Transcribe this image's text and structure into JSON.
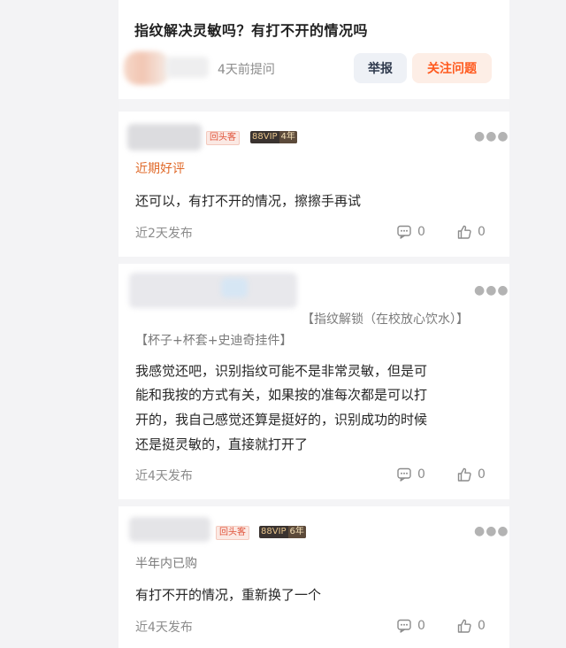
{
  "question": {
    "title": "指纹解决灵敏吗？有打不开的情况吗",
    "asked_time": "4天前提问",
    "report_label": "举报",
    "follow_label": "关注问题"
  },
  "colors": {
    "accent": "#ff5a1f",
    "follow_bg": "#fdeee6",
    "report_bg": "#eef1f6",
    "vip_dark": "#3a3330",
    "return_badge": "#e0533a"
  },
  "answers": [
    {
      "badge_return": "回头客",
      "vip_label": "88VIP",
      "vip_years": "4年",
      "tag": "近期好评",
      "text_lines": [
        "还可以，有打不开的情况，擦擦手再试"
      ],
      "time": "近2天发布",
      "comments": "0",
      "likes": "0"
    },
    {
      "spec": "【指纹解锁（在校放心饮水）】",
      "spec2": "【杯子+杯套+史迪奇挂件】",
      "text_lines": [
        "我感觉还吧，识别指纹可能不是非常灵敏，但是可",
        "能和我按的方式有关，如果按的准每次都是可以打",
        "开的，我自己感觉还算是挺好的，识别成功的时候",
        "还是挺灵敏的，直接就打开了"
      ],
      "time": "近4天发布",
      "comments": "0",
      "likes": "0"
    },
    {
      "badge_return": "回头客",
      "vip_label": "88VIP",
      "vip_years": "6年",
      "tag": "半年内已购",
      "text_lines": [
        "有打不开的情况，重新换了一个"
      ],
      "time": "近4天发布",
      "comments": "0",
      "likes": "0"
    }
  ]
}
